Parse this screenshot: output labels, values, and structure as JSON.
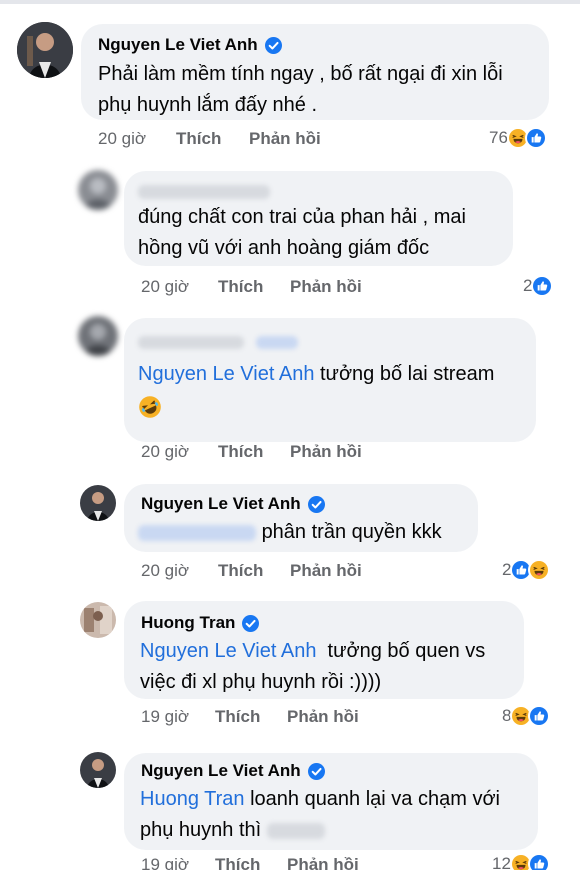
{
  "comments": [
    {
      "author": "Nguyen Le Viet Anh",
      "verified": true,
      "text": "Phải làm mềm tính ngay , bố rất ngại đi xin lỗi phụ huynh lắm đấy nhé .",
      "line1": "Phải làm mềm tính ngay , bố rất ngại đi xin lỗi",
      "line2": "phụ huynh lắm đấy nhé .",
      "time": "20 giờ",
      "like": "Thích",
      "reply": "Phản hồi",
      "reaction_count": "76",
      "reaction_icons": [
        "haha-icon",
        "like-icon"
      ]
    },
    {
      "author": "",
      "verified": false,
      "line1": "đúng chất con trai của phan hải , mai",
      "line2": "hồng vũ với anh hoàng giám đốc",
      "time": "20 giờ",
      "like": "Thích",
      "reply": "Phản hồi",
      "reaction_count": "2",
      "reaction_icons": [
        "like-icon"
      ]
    },
    {
      "author": "",
      "verified": false,
      "mention": "Nguyen Le Viet Anh",
      "line1_rest": " tưởng bố lai stream",
      "emoji": "rofl-emoji",
      "time": "20 giờ",
      "like": "Thích",
      "reply": "Phản hồi"
    },
    {
      "author": "Nguyen Le Viet Anh",
      "verified": true,
      "line1_rest": "phân trần quyền kkk",
      "time": "20 giờ",
      "like": "Thích",
      "reply": "Phản hồi",
      "reaction_count": "2",
      "reaction_icons": [
        "like-icon",
        "haha-icon"
      ]
    },
    {
      "author": "Huong Tran",
      "verified": true,
      "mention": "Nguyen Le Viet Anh",
      "line1_rest": "  tưởng bố quen vs",
      "line2": "việc đi xl phụ huynh rồi :))))",
      "time": "19 giờ",
      "like": "Thích",
      "reply": "Phản hồi",
      "reaction_count": "8",
      "reaction_icons": [
        "haha-icon",
        "like-icon"
      ]
    },
    {
      "author": "Nguyen Le Viet Anh",
      "verified": true,
      "mention": "Huong Tran",
      "line1_rest": " loanh quanh lại va chạm với",
      "line2": "phụ huynh thì",
      "time": "19 giờ",
      "like": "Thích",
      "reply": "Phản hồi",
      "reaction_count": "12",
      "reaction_icons": [
        "haha-icon",
        "like-icon"
      ]
    }
  ],
  "colors": {
    "bubble": "#f0f2f5",
    "meta": "#65676b",
    "mention": "#216fdb",
    "verified": "#1877f2",
    "like": "#1877f2",
    "haha": "#f7b125"
  }
}
